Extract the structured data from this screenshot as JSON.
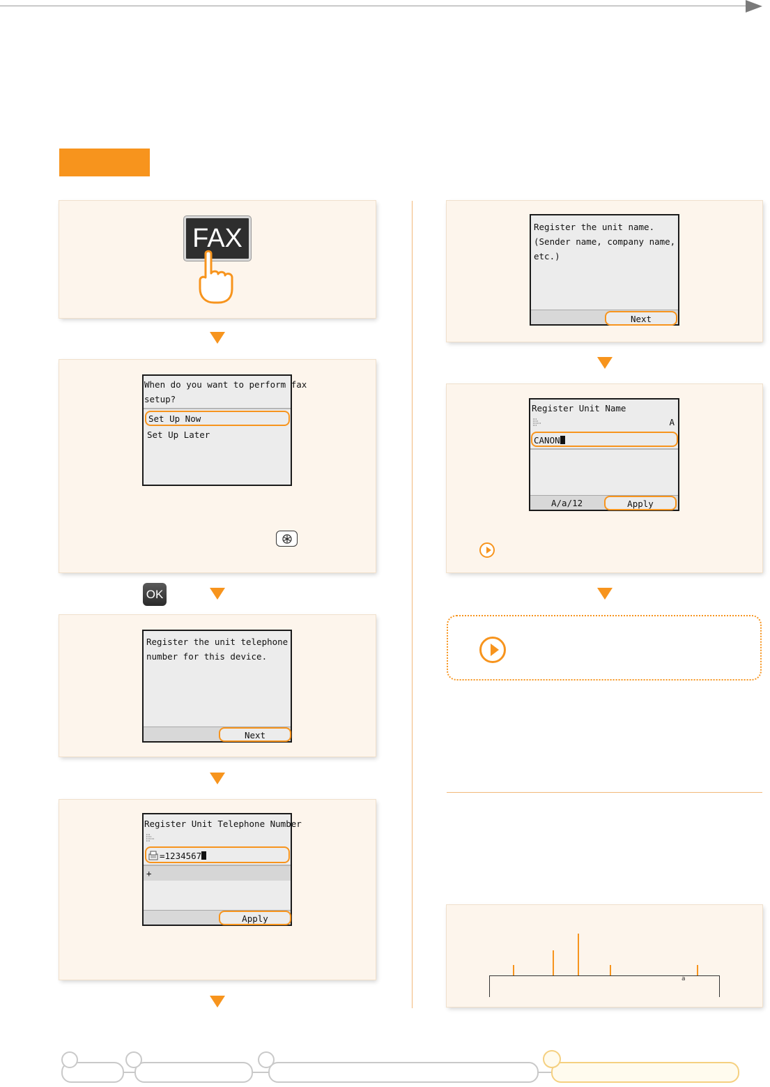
{
  "fax_key": {
    "label": "FAX"
  },
  "screen_setup": {
    "question": "When do you want to perform fax\nsetup?",
    "option_now": "Set Up Now",
    "option_later": "Set Up Later"
  },
  "ok_key": {
    "label": "OK"
  },
  "screen_tel_intro": {
    "text": "Register the unit telephone\nnumber for this device.",
    "next": "Next"
  },
  "screen_tel_entry": {
    "title": "Register Unit Telephone Number",
    "value_prefix": "=",
    "value": "1234567",
    "plus": "+",
    "apply": "Apply"
  },
  "screen_name_intro": {
    "text": "Register the unit name.\n(Sender name, company name,\netc.)",
    "next": "Next"
  },
  "screen_name_entry": {
    "title": "Register Unit Name",
    "mode": "A",
    "value": "CANON",
    "input_mode": "A/a/12",
    "apply": "Apply"
  },
  "ruler": {
    "label": "a"
  }
}
